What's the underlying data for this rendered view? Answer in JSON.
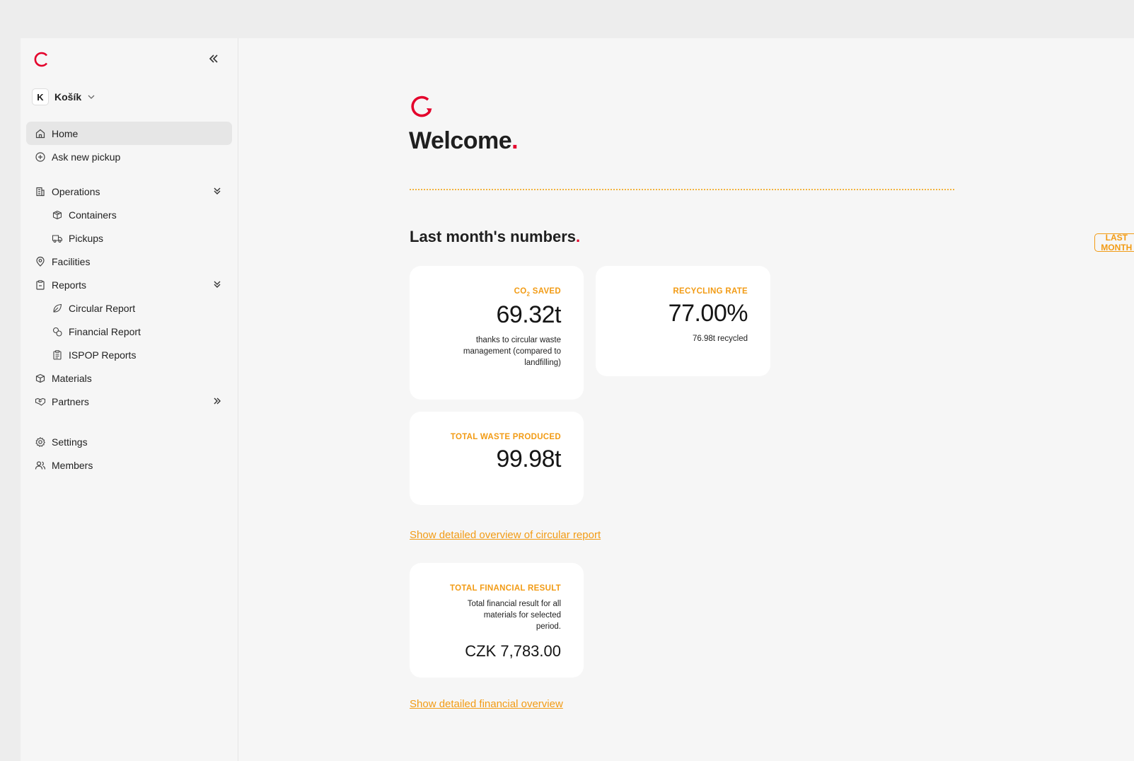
{
  "brand": {
    "accent": "#e4002b",
    "orange": "#f29b14"
  },
  "sidebar": {
    "collapse_icon": "chevrons-left-icon",
    "org": {
      "initial": "K",
      "name": "Košík"
    },
    "items": [
      {
        "label": "Home",
        "icon": "home-icon",
        "active": true
      },
      {
        "label": "Ask new pickup",
        "icon": "plus-circle-icon"
      },
      {
        "label": "Operations",
        "icon": "building-icon"
      },
      {
        "label": "Containers",
        "icon": "box-icon"
      },
      {
        "label": "Pickups",
        "icon": "truck-icon"
      },
      {
        "label": "Facilities",
        "icon": "map-pin-icon"
      },
      {
        "label": "Reports",
        "icon": "clipboard-icon"
      },
      {
        "label": "Circular Report",
        "icon": "leaf-icon"
      },
      {
        "label": "Financial Report",
        "icon": "coins-icon"
      },
      {
        "label": "ISPOP Reports",
        "icon": "clipboard-list-icon"
      },
      {
        "label": "Materials",
        "icon": "package-icon"
      },
      {
        "label": "Partners",
        "icon": "handshake-icon"
      },
      {
        "label": "Settings",
        "icon": "gear-icon"
      },
      {
        "label": "Members",
        "icon": "users-icon"
      }
    ]
  },
  "main": {
    "welcome": "Welcome",
    "section_title": "Last month's numbers",
    "period_button": "LAST MONTH",
    "cards": {
      "co2": {
        "label_prefix": "CO",
        "label_sub": "2",
        "label_suffix": " SAVED",
        "value": "69.32t",
        "sub": "thanks to circular waste management (compared to landfilling)"
      },
      "recycling": {
        "label": "RECYCLING RATE",
        "value": "77.00%",
        "sub": "76.98t recycled"
      },
      "waste": {
        "label": "TOTAL WASTE PRODUCED",
        "value": "99.98t"
      },
      "financial": {
        "label": "TOTAL FINANCIAL RESULT",
        "desc": "Total financial result for all materials for selected period.",
        "value": "CZK 7,783.00"
      }
    },
    "circular_link": "Show detailed overview of circular report",
    "financial_link": "Show detailed financial overview"
  }
}
